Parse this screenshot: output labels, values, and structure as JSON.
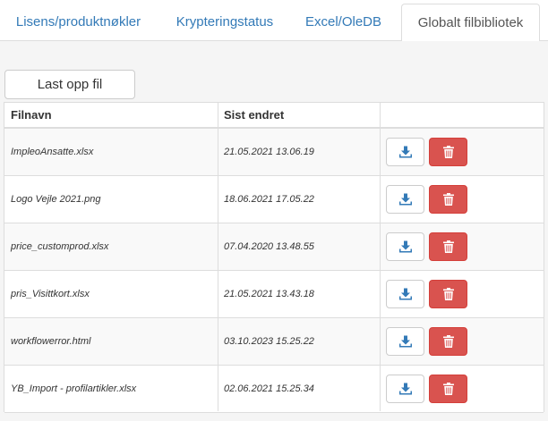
{
  "tabs": [
    {
      "label": "Lisens/produktnøkler",
      "active": false
    },
    {
      "label": "Krypteringstatus",
      "active": false
    },
    {
      "label": "Excel/OleDB",
      "active": false
    },
    {
      "label": "Globalt filbibliotek",
      "active": true
    }
  ],
  "upload_button": "Last opp fil",
  "table": {
    "columns": [
      "Filnavn",
      "Sist endret",
      ""
    ],
    "rows": [
      {
        "name": "ImpleoAnsatte.xlsx",
        "modified": "21.05.2021 13.06.19"
      },
      {
        "name": "Logo Vejle 2021.png",
        "modified": "18.06.2021 17.05.22"
      },
      {
        "name": "price_customprod.xlsx",
        "modified": "07.04.2020 13.48.55"
      },
      {
        "name": "pris_Visittkort.xlsx",
        "modified": "21.05.2021 13.43.18"
      },
      {
        "name": "workflowerror.html",
        "modified": "03.10.2023 15.25.22"
      },
      {
        "name": "YB_Import - profilartikler.xlsx",
        "modified": "02.06.2021 15.25.34"
      }
    ]
  },
  "icons": {
    "download": "download-icon",
    "delete": "trash-icon"
  },
  "colors": {
    "link": "#337ab7",
    "danger": "#d9534f",
    "border": "#dddddd"
  }
}
